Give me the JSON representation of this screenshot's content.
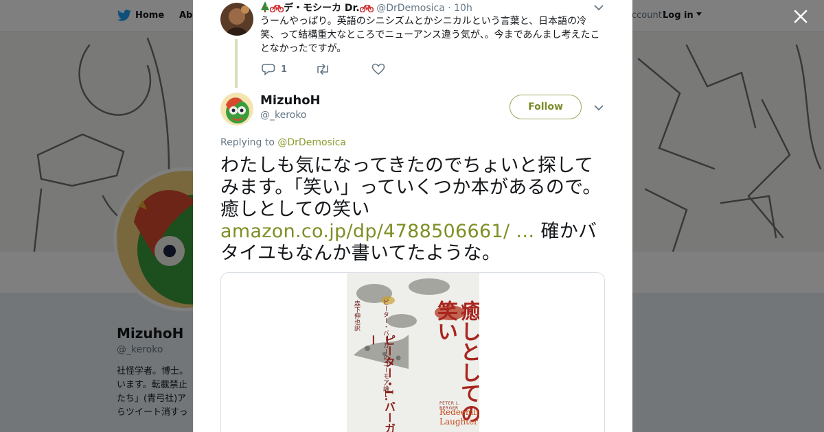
{
  "background": {
    "nav": {
      "home": "Home",
      "about": "Abo",
      "account": "ccount?",
      "login": "Log in"
    },
    "profile": {
      "name": "MizuhoH",
      "handle": "@_keroko",
      "bio_lines": [
        "社怪学者。博士。",
        "います。転載禁止",
        "たち」(青弓社)ア",
        "らツイート消すっ"
      ]
    }
  },
  "modal": {
    "parent_tweet": {
      "display_name": "デ・モシーカ Dr.",
      "handle": "@DrDemosica",
      "time": "· 10h",
      "text": "うーんやっぱり。英語のシニシズムとかシニカルという言葉と、日本語の冷笑、って結構重大なところでニューアンス違う気が、。今まであんまし考えたことなかったですが。",
      "reply_count": "1"
    },
    "tweet": {
      "display_name": "MizuhoH",
      "handle": "@_keroko",
      "follow_label": "Follow",
      "replying_label": "Replying to",
      "replying_to": "@DrDemosica",
      "text_before": "わたしも気になってきたのでちょいと探してみます。「笑い」っていくつか本があるので。癒しとしての笑い",
      "link": "amazon.co.jp/dp/4788506661/ …",
      "text_after": "確かバタイユもなんか書いてたような。"
    },
    "card": {
      "book_title": "癒しとしての笑い",
      "book_author_ja": "ピーター・L.バーガー",
      "book_sub_ja": "ピーター・バーガーのユーモア論",
      "book_translator": "森下伸也訳",
      "book_author_en": "PETER L. BERGER",
      "book_title_en_1": "Redeeming",
      "book_title_en_2": "Laughter"
    }
  },
  "colors": {
    "link": "#7e8f24",
    "follow_border": "#9aa65a",
    "thread_line": "#d6e0b5"
  }
}
